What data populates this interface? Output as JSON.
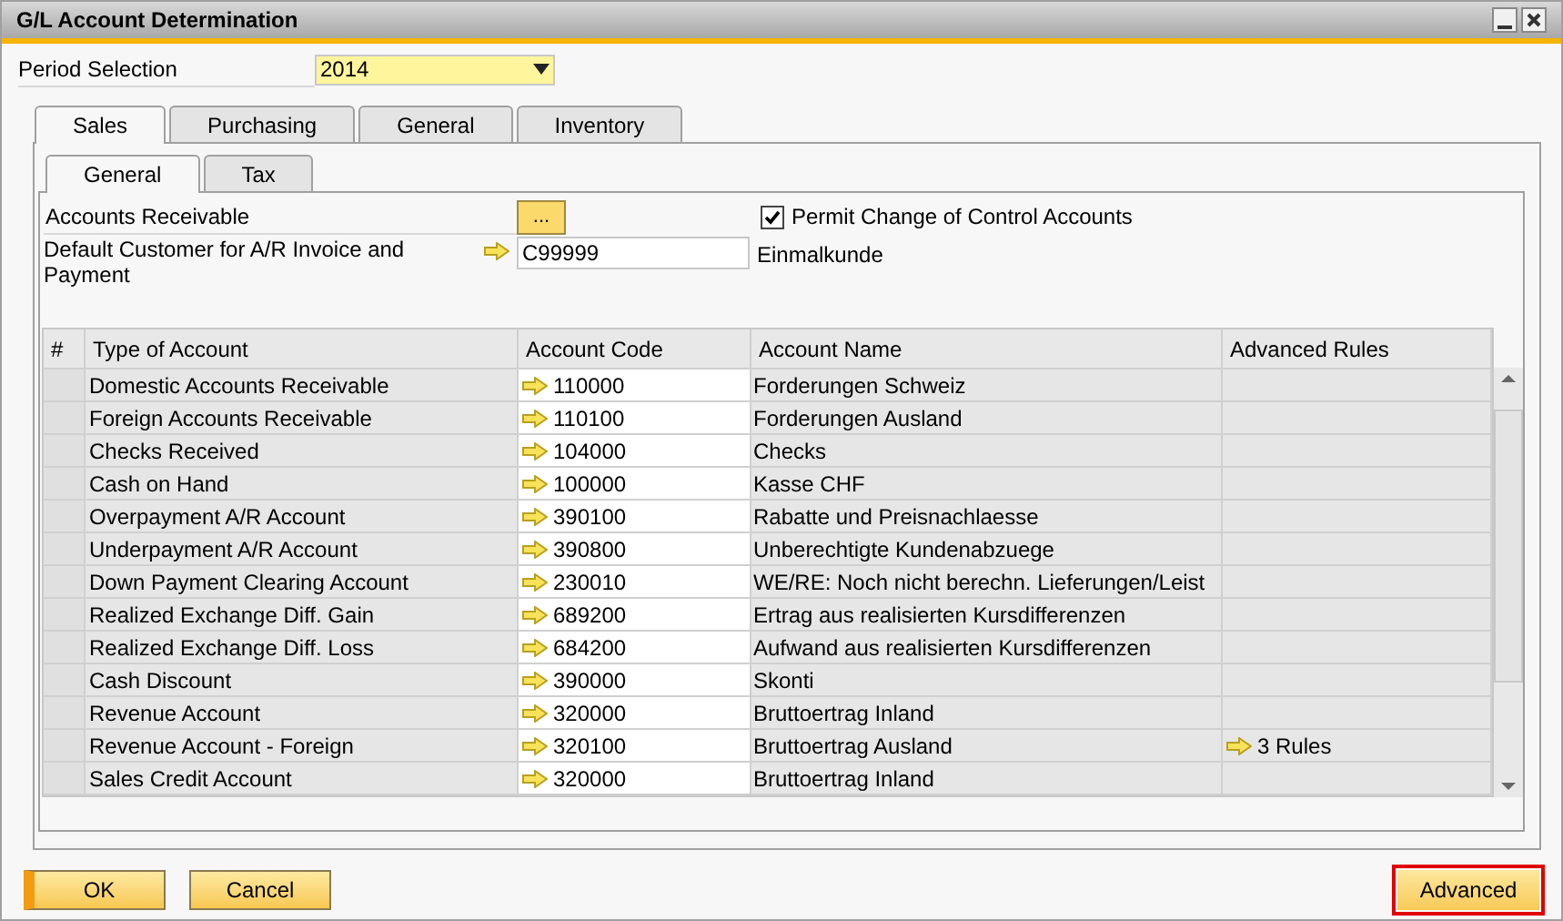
{
  "window": {
    "title": "G/L Account Determination"
  },
  "period_selection": {
    "label": "Period Selection",
    "value": "2014"
  },
  "tabs": [
    {
      "label": "Sales",
      "selected": true
    },
    {
      "label": "Purchasing",
      "selected": false
    },
    {
      "label": "General",
      "selected": false
    },
    {
      "label": "Inventory",
      "selected": false
    }
  ],
  "subtabs": [
    {
      "label": "General",
      "selected": true
    },
    {
      "label": "Tax",
      "selected": false
    }
  ],
  "accounts_receivable": {
    "label": "Accounts Receivable",
    "button_label": "..."
  },
  "permit_change": {
    "label": "Permit Change of Control Accounts",
    "checked": true
  },
  "default_customer": {
    "label": "Default Customer for A/R Invoice and Payment",
    "value": "C99999",
    "name": "Einmalkunde"
  },
  "table": {
    "columns": [
      "#",
      "Type of Account",
      "Account Code",
      "Account Name",
      "Advanced Rules"
    ],
    "rows": [
      {
        "type": "Domestic Accounts Receivable",
        "code": "110000",
        "name": "Forderungen Schweiz"
      },
      {
        "type": "Foreign Accounts Receivable",
        "code": "110100",
        "name": "Forderungen Ausland"
      },
      {
        "type": "Checks Received",
        "code": "104000",
        "name": "Checks"
      },
      {
        "type": "Cash on Hand",
        "code": "100000",
        "name": "Kasse CHF"
      },
      {
        "type": "Overpayment A/R Account",
        "code": "390100",
        "name": "Rabatte und Preisnachlaesse"
      },
      {
        "type": "Underpayment A/R Account",
        "code": "390800",
        "name": "Unberechtigte Kundenabzuege"
      },
      {
        "type": "Down Payment Clearing Account",
        "code": "230010",
        "name": "WE/RE: Noch nicht berechn. Lieferungen/Leist"
      },
      {
        "type": "Realized Exchange Diff. Gain",
        "code": "689200",
        "name": "Ertrag aus realisierten Kursdifferenzen"
      },
      {
        "type": "Realized Exchange Diff. Loss",
        "code": "684200",
        "name": "Aufwand aus realisierten Kursdifferenzen"
      },
      {
        "type": "Cash Discount",
        "code": "390000",
        "name": "Skonti"
      },
      {
        "type": "Revenue Account",
        "code": "320000",
        "name": "Bruttoertrag Inland"
      },
      {
        "type": "Revenue Account - Foreign",
        "code": "320100",
        "name": "Bruttoertrag Ausland",
        "rules": "3 Rules"
      },
      {
        "type": "Sales Credit Account",
        "code": "320000",
        "name": "Bruttoertrag Inland"
      }
    ]
  },
  "buttons": [
    {
      "label": "OK",
      "kind": "default",
      "highlighted": false
    },
    {
      "label": "Cancel",
      "kind": "normal",
      "highlighted": false
    },
    {
      "label": "Advanced",
      "kind": "normal",
      "highlighted": true
    }
  ]
}
